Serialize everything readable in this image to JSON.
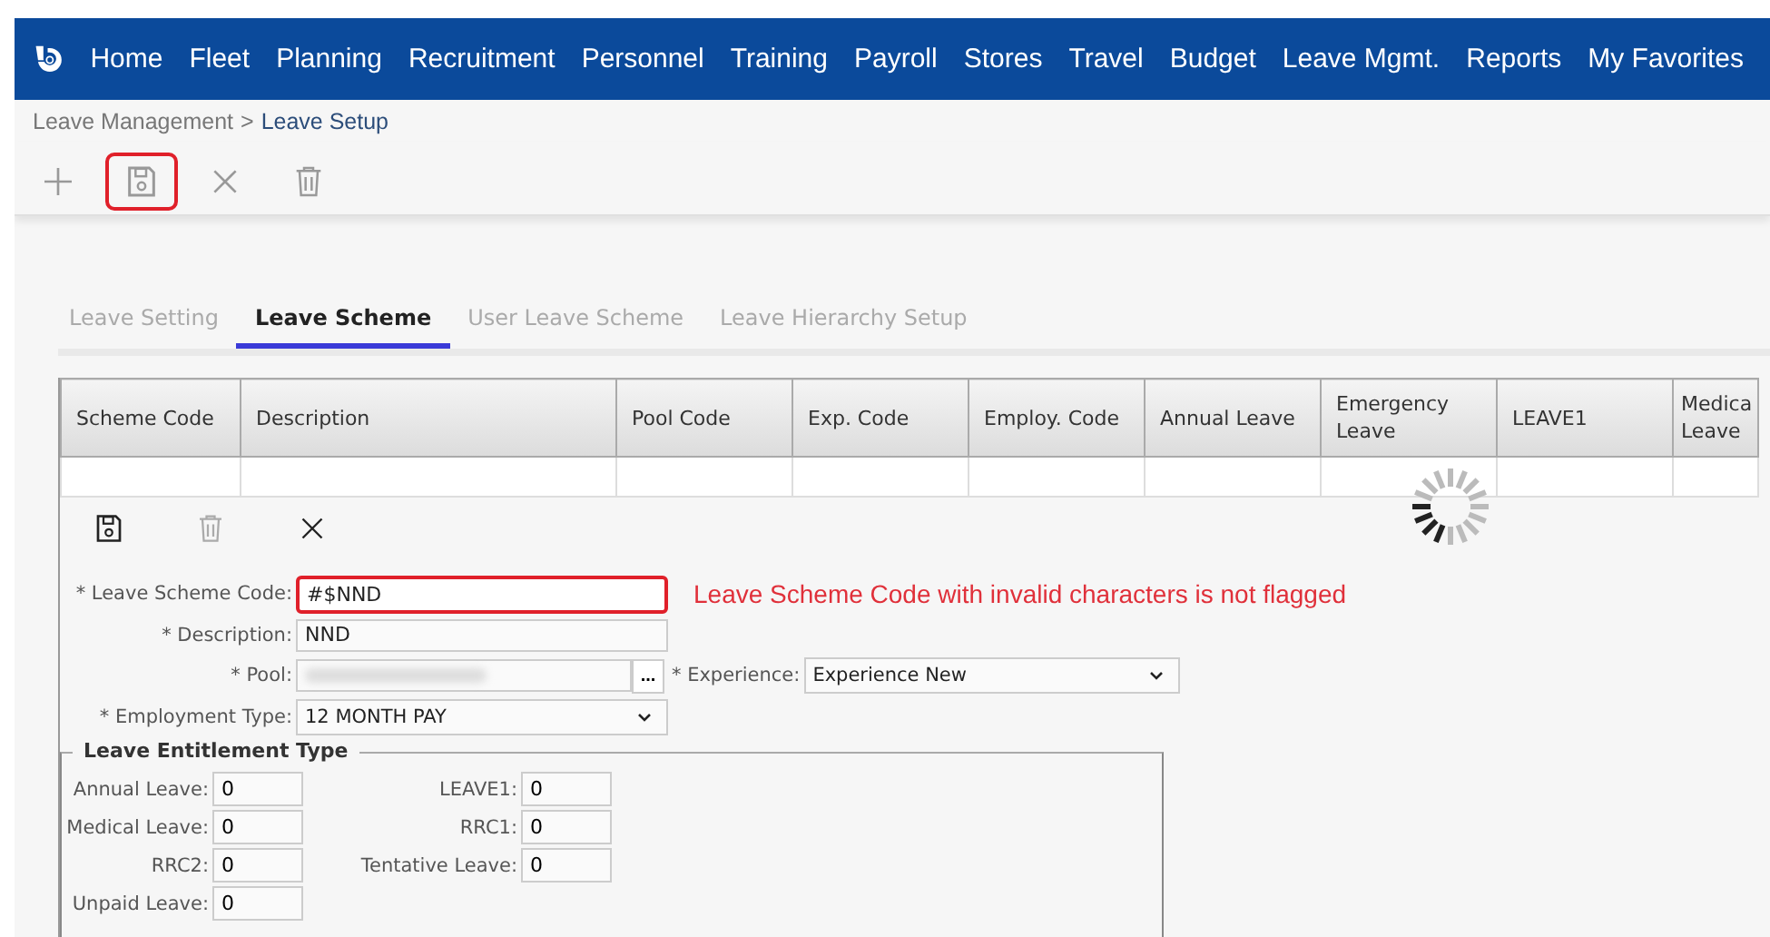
{
  "nav": {
    "items": [
      "Home",
      "Fleet",
      "Planning",
      "Recruitment",
      "Personnel",
      "Training",
      "Payroll",
      "Stores",
      "Travel",
      "Budget",
      "Leave Mgmt.",
      "Reports",
      "My Favorites"
    ]
  },
  "breadcrumb": {
    "parent": "Leave Management",
    "separator": ">",
    "current": "Leave Setup"
  },
  "toolbar": [
    {
      "kind": "add",
      "disabled": true,
      "highlighted": false
    },
    {
      "kind": "save",
      "disabled": true,
      "highlighted": true
    },
    {
      "kind": "cancel",
      "disabled": true,
      "highlighted": false
    },
    {
      "kind": "delete",
      "disabled": true,
      "highlighted": false
    }
  ],
  "tabs": [
    {
      "label": "Leave Setting",
      "selected": false
    },
    {
      "label": "Leave Scheme",
      "selected": true
    },
    {
      "label": "User Leave Scheme",
      "selected": false
    },
    {
      "label": "Leave Hierarchy Setup",
      "selected": false
    }
  ],
  "table": {
    "columns": [
      "Scheme Code",
      "Description",
      "Pool Code",
      "Exp. Code",
      "Employ. Code",
      "Annual Leave",
      "Emergency Leave",
      "LEAVE1",
      "Medica Leave"
    ],
    "loading": true
  },
  "edit_toolbar": [
    {
      "kind": "save",
      "disabled": false
    },
    {
      "kind": "delete",
      "disabled": true
    },
    {
      "kind": "cancel",
      "disabled": false
    }
  ],
  "form": {
    "scheme_code": {
      "label": "* Leave Scheme Code:",
      "value": "#$NND",
      "highlighted": true
    },
    "description": {
      "label": "* Description:",
      "value": "NND"
    },
    "pool": {
      "label": "* Pool:",
      "blurred": true,
      "button": "..."
    },
    "experience": {
      "label": "* Experience:",
      "value": "Experience New"
    },
    "employment_type": {
      "label": "* Employment Type:",
      "value": "12 MONTH PAY"
    }
  },
  "annotation": "Leave Scheme Code with invalid characters is not flagged",
  "entitlement": {
    "title": "Leave Entitlement Type",
    "left": [
      {
        "label": "Annual Leave:",
        "value": "0"
      },
      {
        "label": "Medical Leave:",
        "value": "0"
      },
      {
        "label": "RRC2:",
        "value": "0"
      },
      {
        "label": "Unpaid Leave:",
        "value": "0"
      }
    ],
    "right": [
      {
        "label": "LEAVE1:",
        "value": "0"
      },
      {
        "label": "RRC1:",
        "value": "0"
      },
      {
        "label": "Tentative Leave:",
        "value": "0"
      }
    ]
  }
}
